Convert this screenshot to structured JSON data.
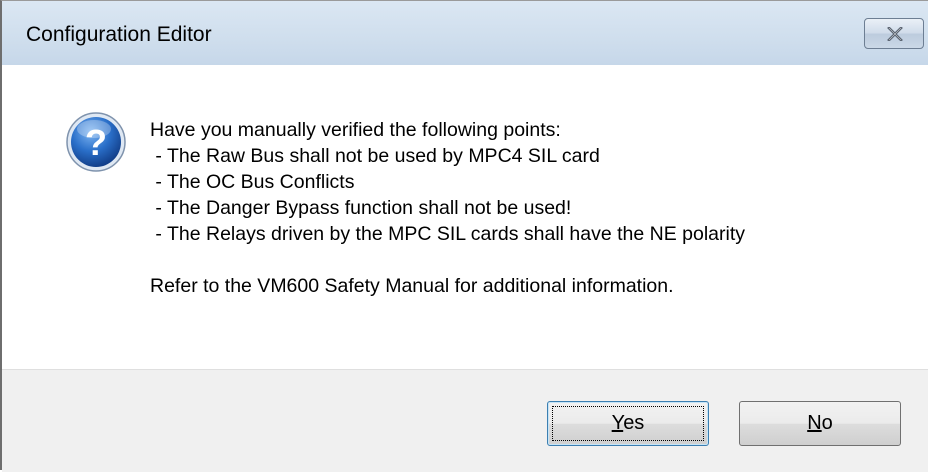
{
  "window": {
    "title": "Configuration Editor",
    "close_icon": "close-icon"
  },
  "dialog": {
    "icon": "question-icon",
    "icon_color": "#2a6fc9",
    "message_lines": [
      "Have you manually verified the following points:",
      " - The Raw Bus shall not be used by MPC4 SIL card",
      " - The OC Bus Conflicts",
      " - The Danger Bypass function shall not be used!",
      " - The Relays driven by the MPC SIL cards shall have the NE polarity",
      "Refer to the VM600 Safety Manual for additional information."
    ]
  },
  "buttons": {
    "yes": {
      "mnemonic": "Y",
      "rest": "es"
    },
    "no": {
      "mnemonic": "N",
      "rest": "o"
    }
  }
}
